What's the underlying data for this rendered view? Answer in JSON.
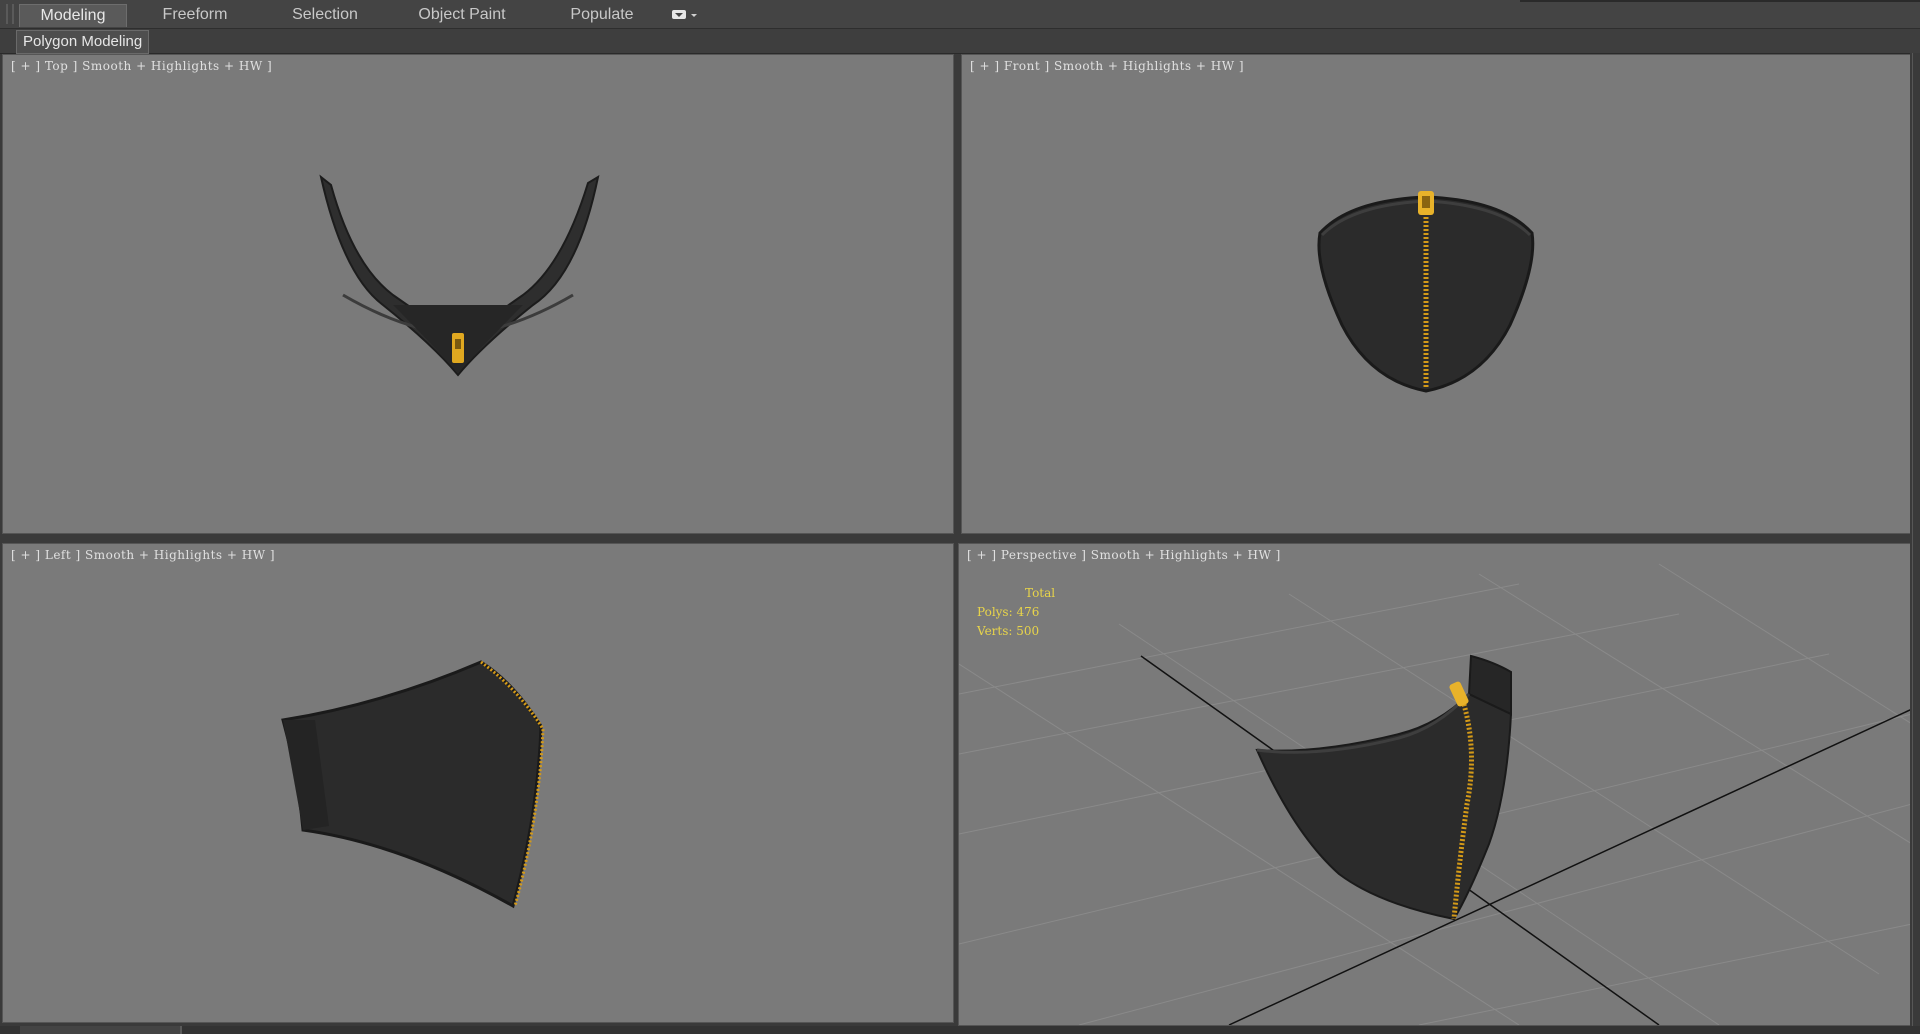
{
  "ribbon": {
    "tabs": [
      {
        "label": "Modeling",
        "active": true
      },
      {
        "label": "Freeform",
        "active": false
      },
      {
        "label": "Selection",
        "active": false
      },
      {
        "label": "Object Paint",
        "active": false
      },
      {
        "label": "Populate",
        "active": false
      }
    ],
    "toggle_icon": "ribbon-minimize-icon"
  },
  "panel": {
    "label": "Polygon Modeling"
  },
  "viewports": {
    "top": {
      "label": "[ + ] Top ] Smooth + Highlights + HW ]"
    },
    "front": {
      "label": "[ + ] Front ] Smooth + Highlights + HW ]"
    },
    "left": {
      "label": "[ + ] Left ] Smooth + Highlights + HW ]"
    },
    "perspective": {
      "label": "[ + ] Perspective ] Smooth + Highlights + HW ]"
    }
  },
  "stats": {
    "total_label": "Total",
    "polys_label": "Polys: 476",
    "verts_label": "Verts: 500"
  },
  "colors": {
    "viewport_bg": "#7a7a7a",
    "mask_fabric": "#2b2b2b",
    "zipper": "#e0a820",
    "stats_text": "#e8d44a",
    "active_tab": "#5a5a5a"
  }
}
